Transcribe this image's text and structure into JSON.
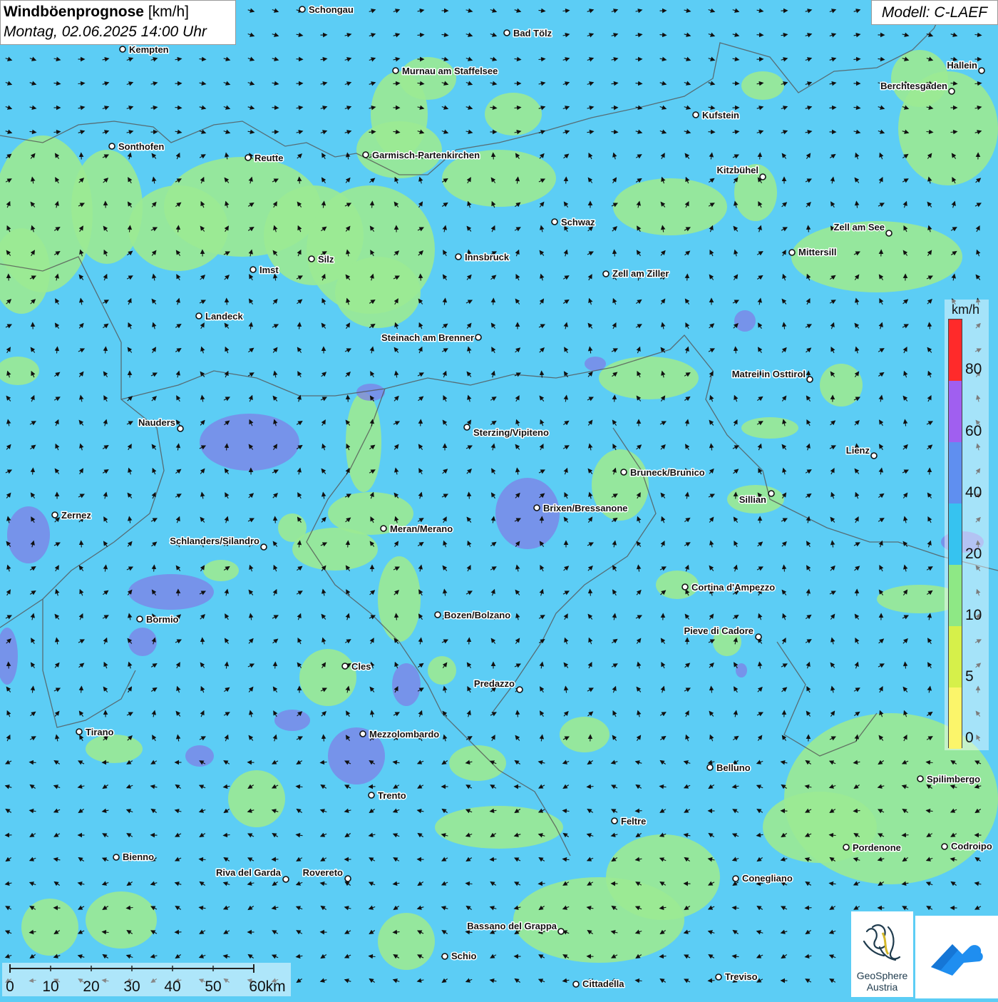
{
  "header": {
    "title_bold": "Windböenprognose",
    "title_unit": "[km/h]",
    "datetime": "Montag, 02.06.2025 14:00 Uhr",
    "model": "Modell: C-LAEF"
  },
  "legend": {
    "unit": "km/h",
    "labels": [
      "80",
      "60",
      "40",
      "20",
      "10",
      "5",
      "0"
    ],
    "colors": [
      "#ff2a2a",
      "#a05ff0",
      "#5f8ff0",
      "#36c3f0",
      "#8ee885",
      "#d6f04a",
      "#fbf56a"
    ]
  },
  "scalebar": {
    "labels": [
      "0",
      "10",
      "20",
      "30",
      "40",
      "50",
      "60km"
    ]
  },
  "logos": {
    "geosphere_line1": "GeoSphere",
    "geosphere_line2": "Austria"
  },
  "colors": {
    "water_bg": "#5ccdf5",
    "calm_patch": "#9bea93",
    "strong_patch": "#7f7fe6",
    "border": "#555555"
  },
  "cities": [
    {
      "name": "Schongau"
    },
    {
      "name": "Bad Tölz"
    },
    {
      "name": "Kempten"
    },
    {
      "name": "Murnau am Staffelsee"
    },
    {
      "name": "Hallein"
    },
    {
      "name": "Berchtesgaden"
    },
    {
      "name": "Kufstein"
    },
    {
      "name": "Sonthofen"
    },
    {
      "name": "Reutte"
    },
    {
      "name": "Garmisch-Partenkirchen"
    },
    {
      "name": "Kitzbühel"
    },
    {
      "name": "Schwaz"
    },
    {
      "name": "Zell am See"
    },
    {
      "name": "Mittersill"
    },
    {
      "name": "Innsbruck"
    },
    {
      "name": "Imst"
    },
    {
      "name": "Silz"
    },
    {
      "name": "Zell am Ziller"
    },
    {
      "name": "Landeck"
    },
    {
      "name": "Steinach am Brenner"
    },
    {
      "name": "Matrei in Osttirol"
    },
    {
      "name": "Nauders"
    },
    {
      "name": "Sterzing/Vipiteno"
    },
    {
      "name": "Lienz"
    },
    {
      "name": "Bruneck/Brunico"
    },
    {
      "name": "Sillian"
    },
    {
      "name": "Zernez"
    },
    {
      "name": "Brixen/Bressanone"
    },
    {
      "name": "Meran/Merano"
    },
    {
      "name": "Schlanders/Silandro"
    },
    {
      "name": "Cortina d'Ampezzo"
    },
    {
      "name": "Bozen/Bolzano"
    },
    {
      "name": "Bormio"
    },
    {
      "name": "Pieve di Cadore"
    },
    {
      "name": "Cles"
    },
    {
      "name": "Predazzo"
    },
    {
      "name": "Tirano"
    },
    {
      "name": "Mezzolombardo"
    },
    {
      "name": "Belluno"
    },
    {
      "name": "Spilimbergo"
    },
    {
      "name": "Trento"
    },
    {
      "name": "Feltre"
    },
    {
      "name": "Pordenone"
    },
    {
      "name": "Codroipo"
    },
    {
      "name": "Bienno"
    },
    {
      "name": "Riva del Garda"
    },
    {
      "name": "Rovereto"
    },
    {
      "name": "Conegliano"
    },
    {
      "name": "Bassano del Grappa"
    },
    {
      "name": "Schio"
    },
    {
      "name": "Treviso"
    },
    {
      "name": "Cittadella"
    }
  ]
}
